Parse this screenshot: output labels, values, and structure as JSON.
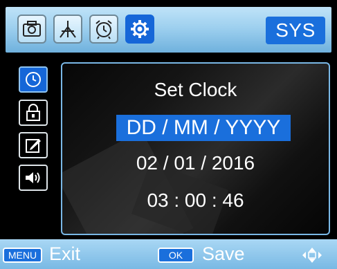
{
  "tabs": [
    {
      "icon": "camera-icon",
      "active": false
    },
    {
      "icon": "tripod-icon",
      "active": false
    },
    {
      "icon": "alarm-clock-icon",
      "active": false
    },
    {
      "icon": "gear-icon",
      "active": true
    }
  ],
  "header": {
    "section_label": "SYS"
  },
  "sidebar": {
    "items": [
      {
        "icon": "clock-icon",
        "active": true
      },
      {
        "icon": "lock-icon",
        "active": false
      },
      {
        "icon": "edit-icon",
        "active": false
      },
      {
        "icon": "speaker-icon",
        "active": false
      }
    ]
  },
  "panel": {
    "title": "Set Clock",
    "format": "DD / MM / YYYY",
    "date": "02 / 01 / 2016",
    "time": "03 : 00 : 46"
  },
  "footer": {
    "menu_key": "MENU",
    "exit_label": "Exit",
    "ok_key": "OK",
    "save_label": "Save",
    "nav_icon": "dpad-icon"
  },
  "colors": {
    "accent": "#1a6fdc",
    "bar": "#9ed0ef"
  }
}
